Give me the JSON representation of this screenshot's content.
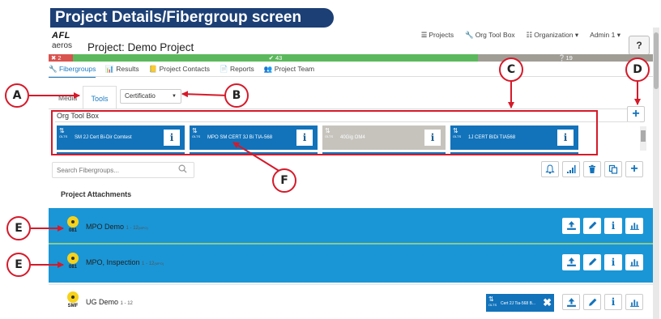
{
  "banner": {
    "title": "Project Details/Fibergroup screen"
  },
  "header": {
    "logo_top": "AFL",
    "logo_bottom": "aeros",
    "project_title": "Project: Demo Project",
    "nav": {
      "projects": "Projects",
      "org_tool_box": "Org Tool Box",
      "organization": "Organization",
      "admin": "Admin 1"
    },
    "help": "?"
  },
  "status": {
    "fail": "2",
    "pass": "43",
    "pending": "19",
    "colors": {
      "fail": "#d9534f",
      "pass": "#5cb85c",
      "pending": "#a09d95"
    }
  },
  "subnav": {
    "fibergroups": "Fibergroups",
    "results": "Results",
    "project_contacts": "Project Contacts",
    "reports": "Reports",
    "project_team": "Project Team"
  },
  "tabs": {
    "media": "Media",
    "tools": "Tools",
    "certification_value": "Certificatio"
  },
  "org_tool_box": {
    "label": "Org Tool Box",
    "tools": [
      {
        "label": "SM 2J Cert Bi-Dir Comtest",
        "icon_code": "OLTS"
      },
      {
        "label": "MPO SM CERT 3J Bi TIA-568",
        "icon_code": "OLTS"
      },
      {
        "label": "40Gig OM4",
        "icon_code": "OLTS"
      },
      {
        "label": "1J CERT BIDi TIA568",
        "icon_code": "OLTS"
      }
    ],
    "add": "+",
    "info": "i"
  },
  "search": {
    "placeholder": "Search Fibergroups..."
  },
  "toolbar": {
    "add": "+"
  },
  "attachments": {
    "title": "Project Attachments"
  },
  "fibergroups": [
    {
      "name": "MPO Demo",
      "count": "1 - 12",
      "unit": "(MPO)",
      "code": "081"
    },
    {
      "name": "MPO, Inspection",
      "count": "1 - 12",
      "unit": "(MPO)",
      "code": "081"
    },
    {
      "name": "UG Demo",
      "count": "1 - 12",
      "unit": "",
      "code": "SMF",
      "tool_chip": "Cert 2J Tia-568 B...",
      "chip_icon_code": "OLTS",
      "chip_close": "✖"
    }
  ],
  "row_actions": {
    "info": "i"
  },
  "callouts": {
    "a": "A",
    "b": "B",
    "c": "C",
    "d": "D",
    "e": "E",
    "f": "F"
  },
  "accent_colors": {
    "primary": "#1273bb",
    "row_highlight": "#1a96d6",
    "annotation": "#d51a2a",
    "banner": "#1c3f75"
  }
}
